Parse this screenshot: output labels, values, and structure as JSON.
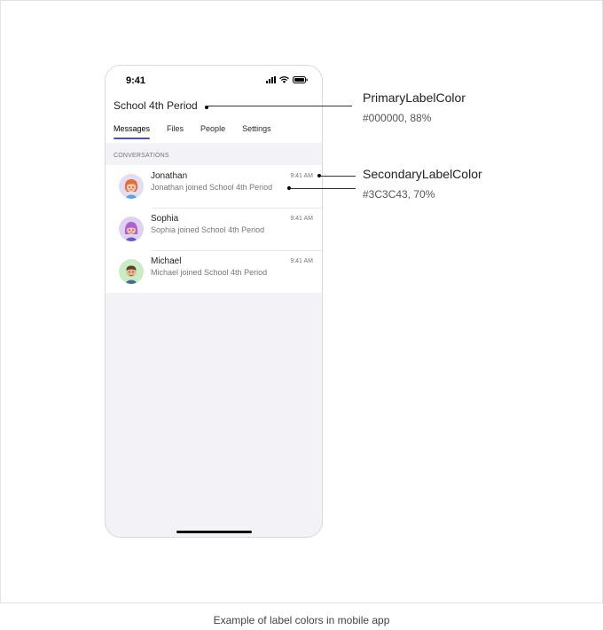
{
  "phone": {
    "status_time": "9:41",
    "chat_title": "School 4th Period",
    "tabs": [
      {
        "label": "Messages",
        "active": true
      },
      {
        "label": "Files",
        "active": false
      },
      {
        "label": "People",
        "active": false
      },
      {
        "label": "Settings",
        "active": false
      }
    ],
    "section_header": "CONVERSATIONS",
    "conversations": [
      {
        "name": "Jonathan",
        "message": "Jonathan joined School 4th Period",
        "time": "9:41 AM",
        "avatar_icon": "woman-avatar-icon"
      },
      {
        "name": "Sophia",
        "message": "Sophia joined School 4th Period",
        "time": "9:41 AM",
        "avatar_icon": "purple-hair-avatar-icon"
      },
      {
        "name": "Michael",
        "message": "Michael joined School 4th Period",
        "time": "9:41 AM",
        "avatar_icon": "man-avatar-icon"
      }
    ]
  },
  "annotations": {
    "primary": {
      "name": "PrimaryLabelColor",
      "value": "#000000, 88%"
    },
    "secondary": {
      "name": "SecondaryLabelColor",
      "value": "#3C3C43, 70%"
    }
  },
  "caption": "Example of label colors in mobile app",
  "colors": {
    "primary_label": "#000000",
    "secondary_label": "#3C3C43",
    "tab_accent": "#4F52B2",
    "list_background": "#F2F2F7"
  }
}
